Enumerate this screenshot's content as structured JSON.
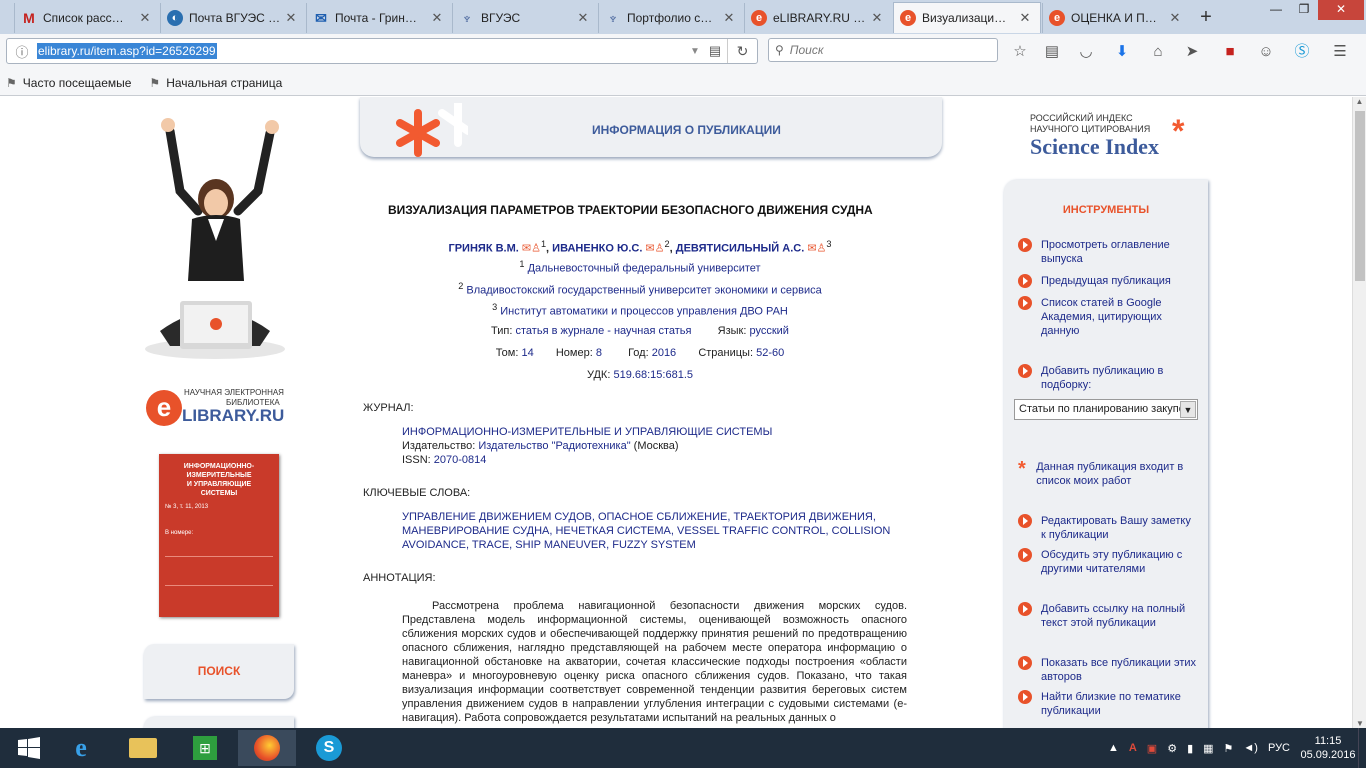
{
  "tabs": [
    {
      "label": "Список расс…",
      "icon": "gmail-icon",
      "color": "#c5221f"
    },
    {
      "label": "Почта ВГУЭС …",
      "icon": "mail-globe-icon",
      "color": "#2a6fb0"
    },
    {
      "label": "Почта - Грин…",
      "icon": "outlook-icon",
      "color": "#1f5fb0"
    },
    {
      "label": "ВГУЭС",
      "icon": "vguess-icon",
      "color": "#2a4a8a"
    },
    {
      "label": "Портфолио с…",
      "icon": "portfolio-icon",
      "color": "#2a4a8a"
    },
    {
      "label": "eLIBRARY.RU …",
      "icon": "elibrary-icon",
      "color": "#e8522a"
    },
    {
      "label": "Визуализаци…",
      "icon": "elibrary-icon",
      "color": "#e8522a",
      "active": true
    },
    {
      "label": "ОЦЕНКА И П…",
      "icon": "elibrary-icon",
      "color": "#e8522a"
    }
  ],
  "new_tab": "+",
  "url": "elibrary.ru/item.asp?id=26526299",
  "search_placeholder": "Поиск",
  "bookmarks": [
    "Часто посещаемые",
    "Начальная страница"
  ],
  "header_title": "ИНФОРМАЦИЯ О ПУБЛИКАЦИИ",
  "brand": {
    "line1": "РОССИЙСКИЙ ИНДЕКС",
    "line2": "НАУЧНОГО ЦИТИРОВАНИЯ",
    "name": "Science Index"
  },
  "elibrary_logo": {
    "line1": "НАУЧНАЯ ЭЛЕКТРОННАЯ",
    "line2": "БИБЛИОТЕКА",
    "name": "LIBRARY.RU"
  },
  "journal_cover": {
    "title1": "ИНФОРМАЦИОННО-ИЗМЕРИТЕЛЬНЫЕ",
    "title2": "И УПРАВЛЯЮЩИЕ",
    "title3": "СИСТЕМЫ",
    "issue": "№ 3, т. 11, 2013",
    "section": "В номере:"
  },
  "search_button": "ПОИСК",
  "article": {
    "title": "ВИЗУАЛИЗАЦИЯ ПАРАМЕТРОВ ТРАЕКТОРИИ БЕЗОПАСНОГО ДВИЖЕНИЯ СУДНА",
    "authors": [
      {
        "name": "ГРИНЯК В.М.",
        "sup": "1"
      },
      {
        "name": "ИВАНЕНКО Ю.С.",
        "sup": "2"
      },
      {
        "name": "ДЕВЯТИСИЛЬНЫЙ А.С.",
        "sup": "3"
      }
    ],
    "affiliations": [
      {
        "sup": "1",
        "name": "Дальневосточный федеральный университет"
      },
      {
        "sup": "2",
        "name": "Владивостокский государственный университет экономики и сервиса"
      },
      {
        "sup": "3",
        "name": "Институт автоматики и процессов управления ДВО РАН"
      }
    ],
    "type_label": "Тип:",
    "type_value": "статья в журнале - научная статья",
    "lang_label": "Язык:",
    "lang_value": "русский",
    "vol_label": "Том:",
    "vol_value": "14",
    "num_label": "Номер:",
    "num_value": "8",
    "year_label": "Год:",
    "year_value": "2016",
    "pages_label": "Страницы:",
    "pages_value": "52-60",
    "udk_label": "УДК:",
    "udk_value": "519.68:15:681.5",
    "journal_heading": "ЖУРНАЛ:",
    "journal_name": "ИНФОРМАЦИОННО-ИЗМЕРИТЕЛЬНЫЕ И УПРАВЛЯЮЩИЕ СИСТЕМЫ",
    "publisher_label": "Издательство:",
    "publisher_value": "Издательство \"Радиотехника\"",
    "publisher_city": "(Москва)",
    "issn_label": "ISSN:",
    "issn_value": "2070-0814",
    "keywords_heading": "КЛЮЧЕВЫЕ СЛОВА:",
    "keywords_line1": "УПРАВЛЕНИЕ ДВИЖЕНИЕМ СУДОВ, ОПАСНОЕ СБЛИЖЕНИЕ, ТРАЕКТОРИЯ ДВИЖЕНИЯ,",
    "keywords_line2": "МАНЕВРИРОВАНИЕ СУДНА, НЕЧЕТКАЯ СИСТЕМА, VESSEL TRAFFIC CONTROL, COLLISION",
    "keywords_line3": "AVOIDANCE, TRACE, SHIP MANEUVER, FUZZY SYSTEM",
    "abstract_heading": "АННОТАЦИЯ:",
    "abstract": "Рассмотрена проблема навигационной безопасности движения морских судов. Представлена модель информационной системы, оценивающей возможность опасного сближения морских судов и обеспечивающей поддержку принятия решений по предотвращению опасного сближения, наглядно представляющей на рабочем месте оператора информацию о навигационной обстановке на акватории, сочетая классические подходы построения «области маневра» и многоуровневую оценку риска опасного сближения судов. Показано, что такая визуализация информации соответствует современной тенденции развития береговых систем управления движением судов в направлении углубления интеграции с судовыми системами (е-навигация). Работа сопровождается результатами испытаний на реальных данных о"
  },
  "tools": {
    "heading": "ИНСТРУМЕНТЫ",
    "items": [
      "Просмотреть оглавление выпуска",
      "Предыдущая публикация",
      "Список статей в Google Академия, цитирующих данную",
      "Добавить публикацию в подборку:"
    ],
    "select_value": "Статьи по планированию закупок",
    "mine": "Данная публикация входит в список моих работ",
    "items2": [
      "Редактировать Вашу заметку к публикации",
      "Обсудить эту публикацию с другими читателями",
      "Добавить ссылку на полный текст этой публикации",
      "Показать все публикации этих авторов",
      "Найти близкие по тематике публикации"
    ]
  },
  "taskbar": {
    "lang": "РУС",
    "time": "11:15",
    "date": "05.09.2016"
  }
}
